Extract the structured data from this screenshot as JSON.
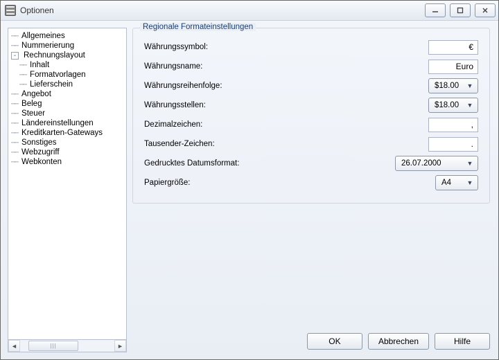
{
  "window": {
    "title": "Optionen"
  },
  "tree": {
    "items": [
      {
        "label": "Allgemeines",
        "type": "leaf"
      },
      {
        "label": "Nummerierung",
        "type": "leaf"
      },
      {
        "label": "Rechnungslayout",
        "type": "expanded"
      },
      {
        "label": "Inhalt",
        "type": "child"
      },
      {
        "label": "Formatvorlagen",
        "type": "child"
      },
      {
        "label": "Lieferschein",
        "type": "child"
      },
      {
        "label": "Angebot",
        "type": "leaf"
      },
      {
        "label": "Beleg",
        "type": "leaf"
      },
      {
        "label": "Steuer",
        "type": "leaf"
      },
      {
        "label": "Ländereinstellungen",
        "type": "leaf"
      },
      {
        "label": "Kreditkarten-Gateways",
        "type": "leaf"
      },
      {
        "label": "Sonstiges",
        "type": "leaf"
      },
      {
        "label": "Webzugriff",
        "type": "leaf"
      },
      {
        "label": "Webkonten",
        "type": "leaf"
      }
    ],
    "scrollbar_grip": "|||"
  },
  "group": {
    "title": "Regionale Formateinstellungen"
  },
  "form": {
    "currency_symbol": {
      "label": "Währungssymbol:",
      "value": "€"
    },
    "currency_name": {
      "label": "Währungsname:",
      "value": "Euro"
    },
    "currency_order": {
      "label": "Währungsreihenfolge:",
      "value": "$18.00"
    },
    "currency_places": {
      "label": "Währungsstellen:",
      "value": "$18.00"
    },
    "decimal_sep": {
      "label": "Dezimalzeichen:",
      "value": ","
    },
    "thousand_sep": {
      "label": "Tausender-Zeichen:",
      "value": "."
    },
    "date_format": {
      "label": "Gedrucktes Datumsformat:",
      "value": "26.07.2000"
    },
    "paper_size": {
      "label": "Papiergröße:",
      "value": "A4"
    }
  },
  "buttons": {
    "ok": "OK",
    "cancel": "Abbrechen",
    "help": "Hilfe"
  }
}
